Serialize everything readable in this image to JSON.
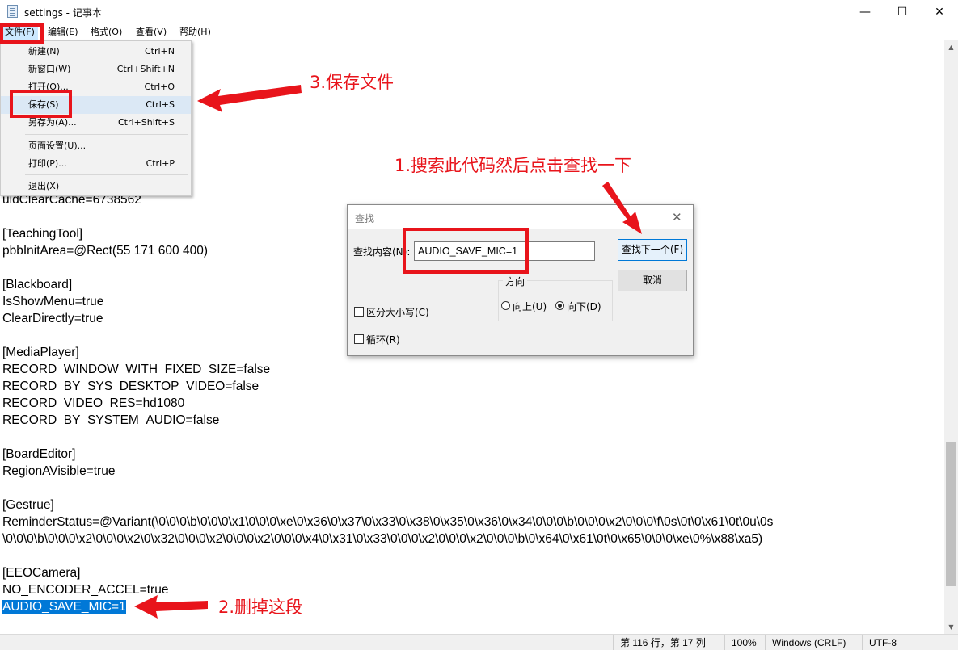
{
  "window": {
    "title": "settings - 记事本",
    "minimize_glyph": "—",
    "maximize_glyph": "☐",
    "close_glyph": "✕"
  },
  "menubar": {
    "items": [
      "文件(F)",
      "编辑(E)",
      "格式(O)",
      "查看(V)",
      "帮助(H)"
    ]
  },
  "file_menu": {
    "items": [
      {
        "label": "新建(N)",
        "shortcut": "Ctrl+N"
      },
      {
        "label": "新窗口(W)",
        "shortcut": "Ctrl+Shift+N"
      },
      {
        "label": "打开(O)...",
        "shortcut": "Ctrl+O"
      },
      {
        "label": "保存(S)",
        "shortcut": "Ctrl+S"
      },
      {
        "label": "另存为(A)...",
        "shortcut": "Ctrl+Shift+S"
      },
      {
        "label": "页面设置(U)...",
        "shortcut": ""
      },
      {
        "label": "打印(P)...",
        "shortcut": "Ctrl+P"
      },
      {
        "label": "退出(X)",
        "shortcut": ""
      }
    ]
  },
  "editor": {
    "lines": [
      "uidClearCache=6738562",
      "",
      "[TeachingTool]",
      "pbbInitArea=@Rect(55 171 600 400)",
      "",
      "[Blackboard]",
      "IsShowMenu=true",
      "ClearDirectly=true",
      "",
      "[MediaPlayer]",
      "RECORD_WINDOW_WITH_FIXED_SIZE=false",
      "RECORD_BY_SYS_DESKTOP_VIDEO=false",
      "RECORD_VIDEO_RES=hd1080",
      "RECORD_BY_SYSTEM_AUDIO=false",
      "",
      "[BoardEditor]",
      "RegionAVisible=true",
      "",
      "[Gestrue]",
      "ReminderStatus=@Variant(\\0\\0\\0\\b\\0\\0\\0\\x1\\0\\0\\0\\xe\\0\\x36\\0\\x37\\0\\x33\\0\\x38\\0\\x35\\0\\x36\\0\\x34\\0\\0\\0\\b\\0\\0\\0\\x2\\0\\0\\0\\f\\0s\\0t\\0\\x61\\0t\\0u\\0s",
      "\\0\\0\\0\\b\\0\\0\\0\\x2\\0\\0\\0\\x2\\0\\x32\\0\\0\\0\\x2\\0\\0\\0\\x2\\0\\0\\0\\x4\\0\\x31\\0\\x33\\0\\0\\0\\x2\\0\\0\\0\\x2\\0\\0\\0\\b\\0\\x64\\0\\x61\\0t\\0\\x65\\0\\0\\0\\xe\\0%\\x88\\xa5)",
      "",
      "[EEOCamera]",
      "NO_ENCODER_ACCEL=true"
    ],
    "selected_line": "AUDIO_SAVE_MIC=1"
  },
  "find_dialog": {
    "title": "查找",
    "find_label": "查找内容(N):",
    "find_value": "AUDIO_SAVE_MIC=1",
    "find_next_button": "查找下一个(F)",
    "cancel_button": "取消",
    "direction_label": "方向",
    "up_label": "向上(U)",
    "down_label": "向下(D)",
    "match_case_label": "区分大小写(C)",
    "wrap_label": "循环(R)",
    "close_glyph": "✕"
  },
  "statusbar": {
    "position": "第 116 行，第 17 列",
    "zoom": "100%",
    "line_ending": "Windows (CRLF)",
    "encoding": "UTF-8"
  },
  "annotations": {
    "step1": "1.搜索此代码然后点击查找一下",
    "step2": "2.删掉这段",
    "step3": "3.保存文件",
    "color": "#e8141b"
  }
}
